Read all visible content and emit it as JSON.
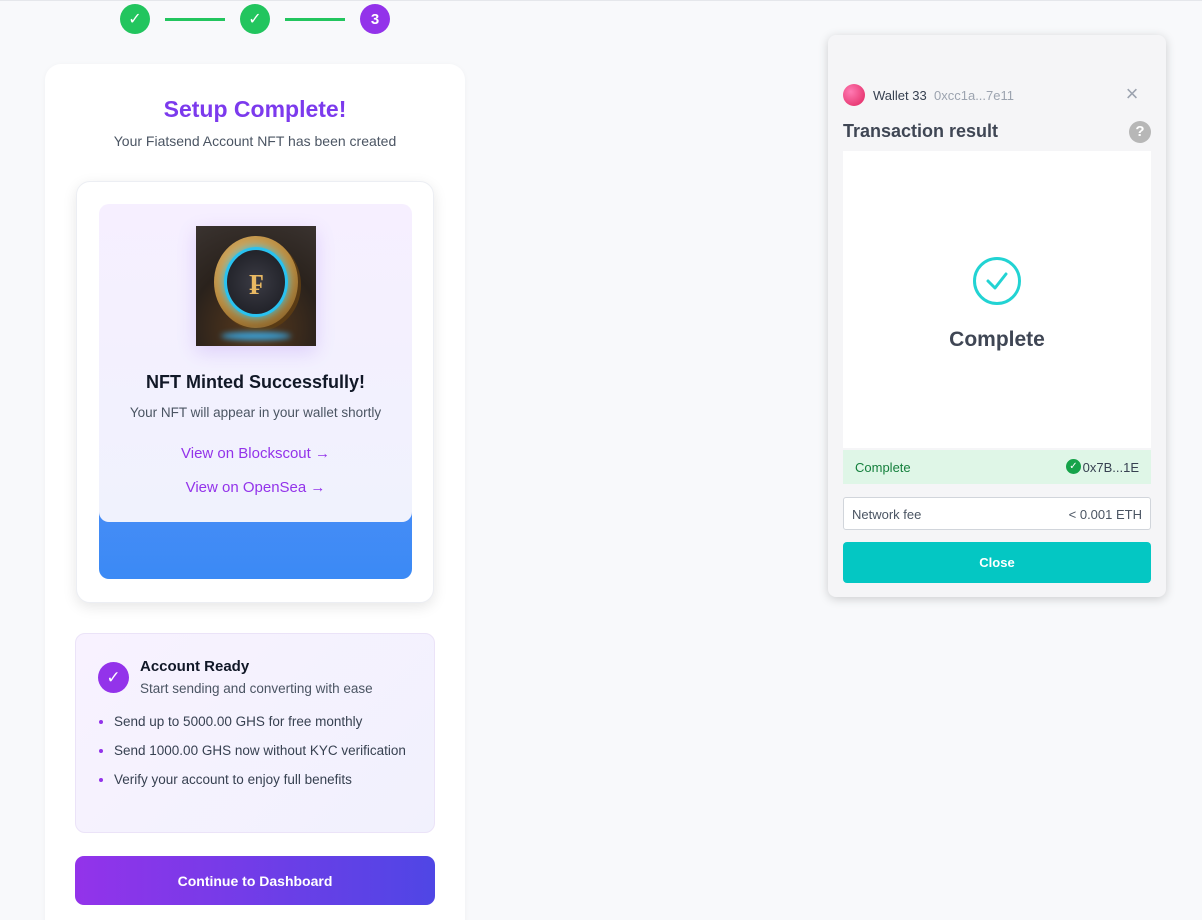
{
  "stepper": {
    "steps": [
      {
        "state": "done",
        "label": "✓"
      },
      {
        "state": "done",
        "label": "✓"
      },
      {
        "state": "active",
        "label": "3"
      }
    ]
  },
  "main": {
    "title": "Setup Complete!",
    "subtitle": "Your Fiatsend Account NFT has been created",
    "nft": {
      "title": "NFT Minted Successfully!",
      "subtitle": "Your NFT will appear in your wallet shortly",
      "link_blockscout": "View on Blockscout →",
      "link_opensea": "View on OpenSea →",
      "coin_glyph": "₣"
    },
    "account": {
      "check": "✓",
      "title": "Account Ready",
      "subtitle": "Start sending and converting with ease",
      "benefits": [
        "Send up to 5000.00 GHS for free monthly",
        "Send 1000.00 GHS now without KYC verification",
        "Verify your account to enjoy full benefits"
      ]
    },
    "continue_label": "Continue to Dashboard"
  },
  "wallet": {
    "name": "Wallet 33",
    "address": "0xcc1a...7e11",
    "close_icon": "×",
    "title": "Transaction result",
    "help_icon": "?",
    "status_big": "Complete",
    "status_label": "Complete",
    "tx_hash": "0x7B...1E",
    "fee_label": "Network fee",
    "fee_value": "< 0.001 ETH",
    "close_label": "Close"
  },
  "colors": {
    "accent_purple": "#9333ea",
    "success_green": "#22c55e",
    "wallet_teal": "#04c7c3"
  }
}
